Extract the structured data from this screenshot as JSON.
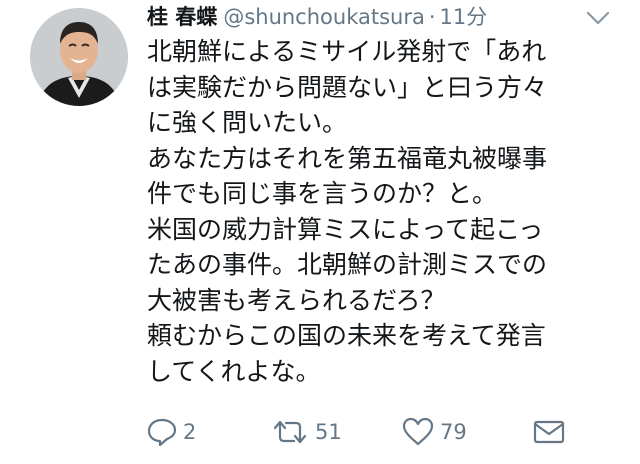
{
  "tweet": {
    "display_name": "桂 春蝶",
    "handle": "@shunchoukatsura",
    "separator": "·",
    "time": "11分",
    "lines": [
      "北朝鮮によるミサイル発射で「あれ",
      "は実験だから問題ない」と曰う方々",
      "に強く問いたい。",
      "あなた方はそれを第五福竜丸被曝事",
      "件でも同じ事を言うのか？と。",
      "米国の威力計算ミスによって起こっ",
      "たあの事件。北朝鮮の計測ミスでの",
      "大被害も考えられるだろ？",
      "頼むからこの国の未来を考えて発言",
      "してくれよな。"
    ],
    "actions": {
      "reply_count": "2",
      "retweet_count": "51",
      "like_count": "79"
    }
  },
  "icons": {
    "avatar": "avatar",
    "menu": "chevron-down-icon",
    "reply": "reply-icon",
    "retweet": "retweet-icon",
    "like": "heart-icon",
    "dm": "envelope-icon"
  },
  "colors": {
    "text": "#14171a",
    "secondary": "#657786",
    "background": "#ffffff"
  }
}
